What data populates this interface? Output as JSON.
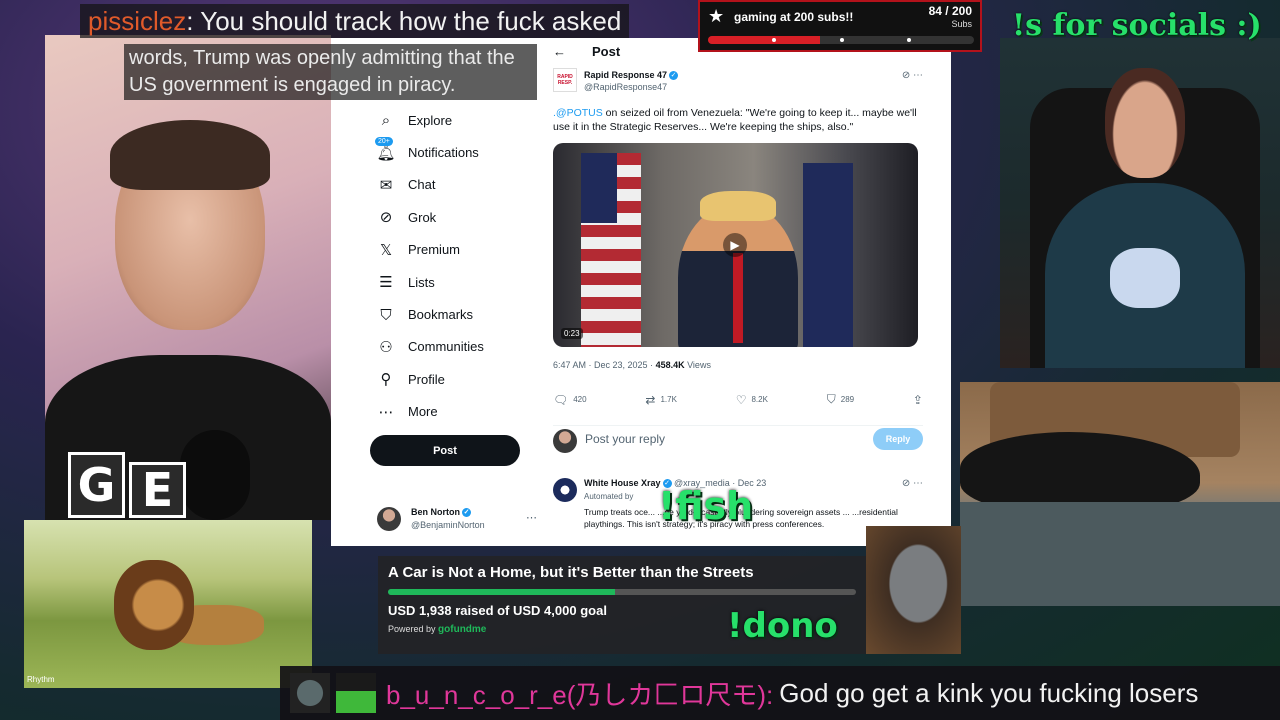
{
  "chat_top": {
    "user": "pissiclez",
    "message": "You should track how the fuck asked"
  },
  "caption": "words, Trump was openly admitting that the US government is engaged in piracy.",
  "ge_logo": {
    "left": "G",
    "right": "E"
  },
  "x_nav": {
    "items": [
      {
        "icon": "search-icon",
        "label": "Explore"
      },
      {
        "icon": "bell-icon",
        "label": "Notifications",
        "badge": "20+"
      },
      {
        "icon": "mail-icon",
        "label": "Chat"
      },
      {
        "icon": "grok-icon",
        "label": "Grok"
      },
      {
        "icon": "x-logo-icon",
        "label": "Premium"
      },
      {
        "icon": "list-icon",
        "label": "Lists"
      },
      {
        "icon": "bookmark-icon",
        "label": "Bookmarks"
      },
      {
        "icon": "communities-icon",
        "label": "Communities"
      },
      {
        "icon": "person-icon",
        "label": "Profile"
      },
      {
        "icon": "more-icon",
        "label": "More"
      }
    ],
    "post_button": "Post",
    "account": {
      "name": "Ben Norton",
      "handle": "@BenjaminNorton"
    }
  },
  "post": {
    "header": "Post",
    "author": {
      "name": "Rapid Response 47",
      "handle": "@RapidResponse47"
    },
    "mention": ".@POTUS",
    "text": " on seized oil from Venezuela: \"We're going to keep it... maybe we'll use it in the Strategic Reserves... We're keeping the ships, also.\"",
    "video_duration": "0:23",
    "timestamp": "6:47 AM · Dec 23, 2025 · ",
    "views": "458.4K",
    "views_label": " Views",
    "replies": "420",
    "reposts": "1.7K",
    "likes": "8.2K",
    "bookmarks": "289",
    "reply_placeholder": "Post your reply",
    "reply_button": "Reply"
  },
  "reply": {
    "name": "White House Xray",
    "handle": "@xray_media",
    "date": "· Dec 23",
    "automated": "Automated by",
    "text": "Trump treats oce... ...ge yard—casually plundering sovereign assets ... ...residential playthings. This isn't strategy; it's piracy with press conferences."
  },
  "sub_goal": {
    "title": "gaming at 200 subs!!",
    "count": "84 / 200",
    "unit": "Subs",
    "progress": 0.42
  },
  "socials": "!s for socials :)",
  "fish_command": "!fish",
  "gofundme": {
    "title": "A Car is Not a Home, but it's Better than the Streets",
    "raised": "USD 1,938 raised of USD 4,000 goal",
    "progress": 0.4845,
    "powered_by": "Powered by",
    "brand": "gofundme"
  },
  "dono_command": "!dono",
  "lion_watermark": "Rhythm",
  "chat_bottom": {
    "user": "b_u_n_c_o_r_e(乃しカ匚ロ尺モ):",
    "message": "God go get a kink you fucking losers"
  }
}
